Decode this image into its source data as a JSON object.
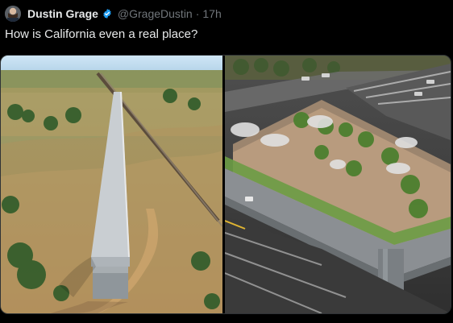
{
  "tweet": {
    "author_name": "Dustin Grage",
    "handle": "@GrageDustin",
    "separator": "·",
    "time": "17h",
    "text": "How is California even a real place?"
  },
  "icons": {
    "verified": "verified-badge-icon",
    "avatar": "avatar"
  },
  "colors": {
    "background": "#000000",
    "text": "#e7e9ea",
    "muted": "#71767b",
    "verified": "#1d9bf0"
  },
  "media": [
    {
      "name": "overpass-to-nowhere-photo"
    },
    {
      "name": "freeway-overpass-with-greenery-photo"
    }
  ]
}
